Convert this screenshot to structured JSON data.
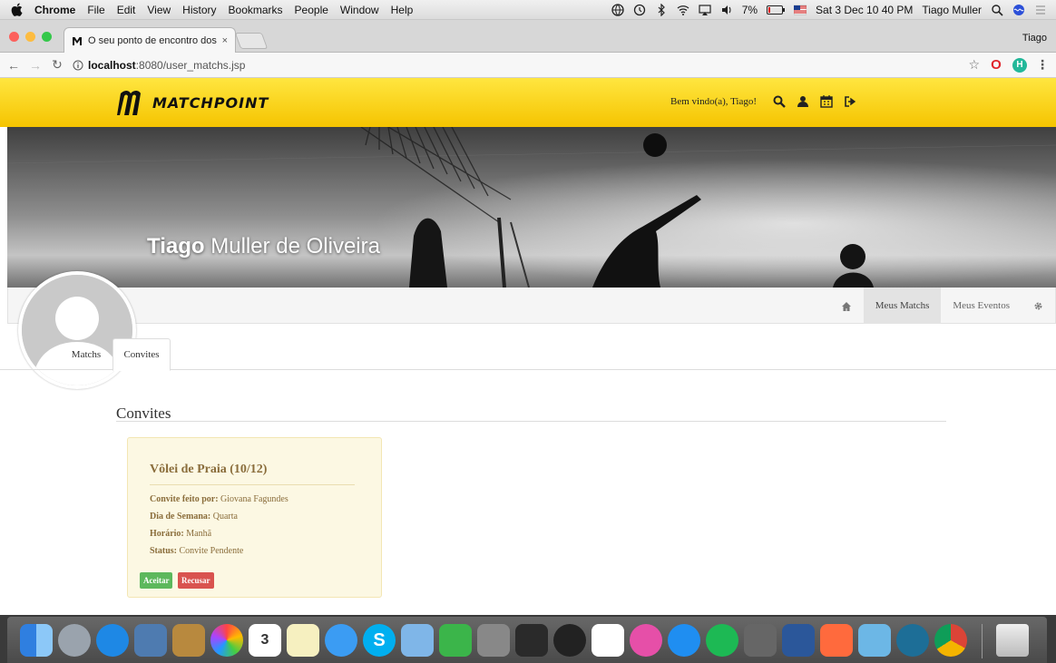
{
  "menubar": {
    "app_name": "Chrome",
    "menus": [
      "File",
      "Edit",
      "View",
      "History",
      "Bookmarks",
      "People",
      "Window",
      "Help"
    ],
    "battery": "7%",
    "clock": "Sat 3 Dec  10 40 PM",
    "user": "Tiago Muller"
  },
  "browser": {
    "tab_title": "O seu ponto de encontro dos e",
    "tab_close": "×",
    "profile": "Tiago",
    "url_host": "localhost",
    "url_path": ":8080/user_matchs.jsp",
    "ext_labels": [
      "O",
      "H"
    ]
  },
  "site": {
    "logo_text": "MATCHPOINT",
    "welcome": "Bem vindo(a), Tiago!"
  },
  "profile": {
    "first_name": "Tiago",
    "last_name": " Muller de Oliveira",
    "nav": [
      {
        "label": "Meus Matchs",
        "active": true
      },
      {
        "label": "Meus Eventos",
        "active": false
      }
    ]
  },
  "tabs": {
    "matchs": "Matchs",
    "convites": "Convites"
  },
  "section": {
    "title": "Convites"
  },
  "invite": {
    "title": "Vôlei de Praia (10/12)",
    "by_label": "Convite feito por:",
    "by_value": " Giovana Fagundes",
    "day_label": "Dia de Semana:",
    "day_value": " Quarta",
    "time_label": "Horário:",
    "time_value": " Manhã",
    "status_label": "Status:",
    "status_value": " Convite Pendente",
    "accept": "Aceitar",
    "reject": "Recusar"
  },
  "dock": {
    "calendar_day": "3"
  },
  "colors": {
    "header_yellow": "#f9d21a",
    "accept_green": "#5cb85c",
    "reject_red": "#d9534f",
    "card_bg": "#fcf8e3",
    "card_text": "#8a6d3b"
  }
}
